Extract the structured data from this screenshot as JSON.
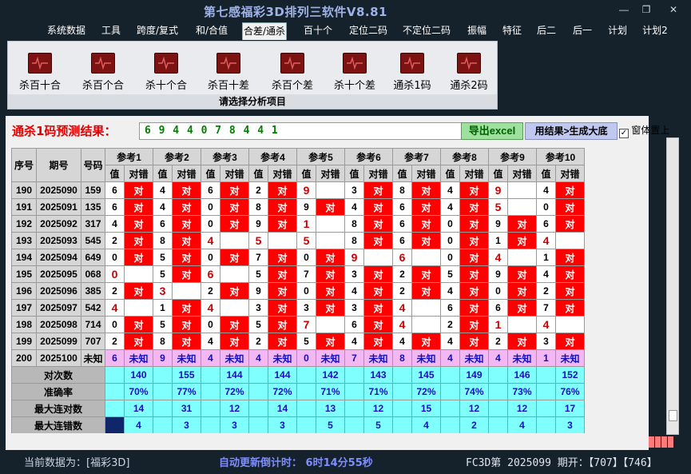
{
  "window": {
    "title": "第七感福彩3D排列三软件V8.81",
    "min": "—",
    "max": "❐",
    "close": "✕"
  },
  "menu": [
    "系统数据",
    "工具",
    "跨度/复式",
    "和/合值",
    "合差/通杀",
    "百十个",
    "定位二码",
    "不定位二码",
    "振幅",
    "特征",
    "后二",
    "后一",
    "计划",
    "计划2"
  ],
  "menu_active": 4,
  "ribbon": {
    "buttons": [
      "杀百十合",
      "杀百个合",
      "杀十个合",
      "杀百十差",
      "杀百个差",
      "杀十个差",
      "通杀1码",
      "通杀2码"
    ],
    "footer": "请选择分析项目"
  },
  "prediction": {
    "label": "通杀1码预测结果：",
    "value": "6 9 4 4 0 7 8 4 4 1"
  },
  "buttons": {
    "export": "导出excel",
    "generate": "用结果>生成大底",
    "topmost": "窗体置上",
    "topmost_checked": "✓"
  },
  "grid": {
    "fixed_headers": [
      "序号",
      "期号",
      "号码"
    ],
    "groups": [
      "参考1",
      "参考2",
      "参考3",
      "参考4",
      "参考5",
      "参考6",
      "参考7",
      "参考8",
      "参考9",
      "参考10"
    ],
    "sub_value": "值",
    "sub_result": "对错",
    "hit_text": "对",
    "rows": [
      {
        "seq": "190",
        "issue": "2025090",
        "num": "159",
        "vals": [
          "6",
          "4",
          "6",
          "2",
          "9",
          "3",
          "8",
          "4",
          "9",
          "4"
        ],
        "hits": [
          1,
          1,
          1,
          1,
          0,
          1,
          1,
          1,
          0,
          1
        ],
        "big": [
          0,
          0,
          0,
          0,
          1,
          0,
          0,
          0,
          1,
          0
        ]
      },
      {
        "seq": "191",
        "issue": "2025091",
        "num": "135",
        "vals": [
          "6",
          "4",
          "0",
          "8",
          "9",
          "4",
          "6",
          "4",
          "5",
          "0"
        ],
        "hits": [
          1,
          1,
          1,
          1,
          1,
          1,
          1,
          1,
          0,
          1
        ],
        "big": [
          0,
          0,
          0,
          0,
          0,
          0,
          0,
          0,
          1,
          0
        ]
      },
      {
        "seq": "192",
        "issue": "2025092",
        "num": "317",
        "vals": [
          "4",
          "6",
          "0",
          "9",
          "1",
          "8",
          "6",
          "0",
          "9",
          "6"
        ],
        "hits": [
          1,
          1,
          1,
          1,
          0,
          1,
          1,
          1,
          1,
          1
        ],
        "big": [
          0,
          0,
          0,
          0,
          1,
          0,
          0,
          0,
          0,
          0
        ]
      },
      {
        "seq": "193",
        "issue": "2025093",
        "num": "545",
        "vals": [
          "2",
          "8",
          "4",
          "5",
          "5",
          "8",
          "6",
          "0",
          "1",
          "4"
        ],
        "hits": [
          1,
          1,
          0,
          0,
          0,
          1,
          1,
          1,
          1,
          0
        ],
        "big": [
          0,
          0,
          1,
          1,
          1,
          0,
          0,
          0,
          0,
          1
        ]
      },
      {
        "seq": "194",
        "issue": "2025094",
        "num": "649",
        "vals": [
          "0",
          "5",
          "0",
          "7",
          "0",
          "9",
          "6",
          "0",
          "4",
          "1"
        ],
        "hits": [
          1,
          1,
          1,
          1,
          1,
          0,
          0,
          1,
          0,
          1
        ],
        "big": [
          0,
          0,
          0,
          0,
          0,
          1,
          1,
          0,
          1,
          0
        ]
      },
      {
        "seq": "195",
        "issue": "2025095",
        "num": "068",
        "vals": [
          "0",
          "5",
          "6",
          "5",
          "7",
          "3",
          "2",
          "5",
          "9",
          "4"
        ],
        "hits": [
          0,
          1,
          0,
          1,
          1,
          1,
          1,
          1,
          1,
          1
        ],
        "big": [
          1,
          0,
          1,
          0,
          0,
          0,
          0,
          0,
          0,
          0
        ]
      },
      {
        "seq": "196",
        "issue": "2025096",
        "num": "385",
        "vals": [
          "2",
          "3",
          "2",
          "9",
          "0",
          "4",
          "2",
          "4",
          "0",
          "2"
        ],
        "hits": [
          1,
          0,
          1,
          1,
          1,
          1,
          1,
          1,
          1,
          1
        ],
        "big": [
          0,
          1,
          0,
          0,
          0,
          0,
          0,
          0,
          0,
          0
        ]
      },
      {
        "seq": "197",
        "issue": "2025097",
        "num": "542",
        "vals": [
          "4",
          "1",
          "4",
          "3",
          "3",
          "3",
          "4",
          "6",
          "6",
          "7"
        ],
        "hits": [
          0,
          1,
          0,
          1,
          1,
          1,
          0,
          1,
          1,
          1
        ],
        "big": [
          1,
          0,
          1,
          0,
          0,
          0,
          1,
          0,
          0,
          0
        ]
      },
      {
        "seq": "198",
        "issue": "2025098",
        "num": "714",
        "vals": [
          "0",
          "5",
          "0",
          "5",
          "7",
          "6",
          "4",
          "2",
          "1",
          "4"
        ],
        "hits": [
          1,
          1,
          1,
          1,
          0,
          1,
          0,
          1,
          0,
          0
        ],
        "big": [
          0,
          0,
          0,
          0,
          1,
          0,
          1,
          0,
          1,
          1
        ]
      },
      {
        "seq": "199",
        "issue": "2025099",
        "num": "707",
        "vals": [
          "2",
          "8",
          "4",
          "2",
          "5",
          "4",
          "4",
          "4",
          "2",
          "3"
        ],
        "hits": [
          1,
          1,
          1,
          1,
          1,
          1,
          1,
          1,
          1,
          1
        ],
        "big": [
          0,
          0,
          0,
          0,
          0,
          0,
          0,
          0,
          0,
          0
        ]
      }
    ],
    "unknown_row": {
      "seq": "200",
      "issue": "2025100",
      "num": "未知",
      "vals": [
        "6",
        "9",
        "4",
        "4",
        "0",
        "7",
        "8",
        "4",
        "4",
        "1"
      ],
      "result": "未知"
    },
    "stats": [
      {
        "label": "对次数",
        "values": [
          "140",
          "155",
          "144",
          "144",
          "142",
          "143",
          "145",
          "149",
          "146",
          "152"
        ]
      },
      {
        "label": "准确率",
        "values": [
          "70%",
          "77%",
          "72%",
          "72%",
          "71%",
          "71%",
          "72%",
          "74%",
          "73%",
          "76%"
        ]
      },
      {
        "label": "最大连对数",
        "values": [
          "14",
          "31",
          "12",
          "14",
          "13",
          "12",
          "15",
          "12",
          "12",
          "17"
        ]
      },
      {
        "label": "最大连错数",
        "values": [
          "4",
          "3",
          "3",
          "3",
          "5",
          "5",
          "4",
          "2",
          "4",
          "3"
        ]
      }
    ]
  },
  "status": {
    "data_source": "当前数据为：[福彩3D]",
    "countdown": "自动更新倒计时： 6时14分55秒",
    "draw": "FC3D第 2025099 期开：【707】【746】"
  }
}
